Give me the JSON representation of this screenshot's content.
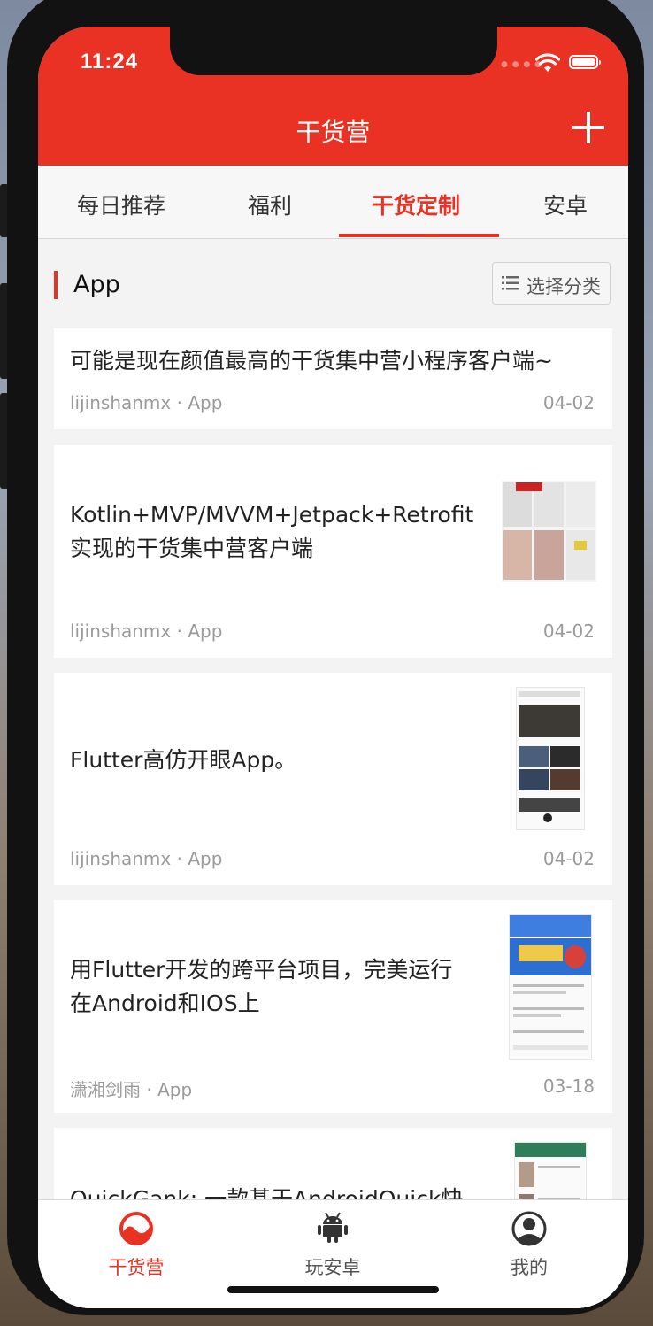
{
  "status_bar": {
    "time": "11:24"
  },
  "nav": {
    "title": "干货营"
  },
  "tabs": [
    {
      "label": "每日推荐"
    },
    {
      "label": "福利"
    },
    {
      "label": "干货定制"
    },
    {
      "label": "安卓"
    }
  ],
  "active_tab": "干货定制",
  "section": {
    "title": "App",
    "category_button": "选择分类"
  },
  "articles": [
    {
      "title": "可能是现在颜值最高的干货集中营小程序客户端~",
      "author": "lijinshanmx",
      "category": "App",
      "date": "04-02"
    },
    {
      "title": "Kotlin+MVP/MVVM+Jetpack+Retrofit实现的干货集中营客户端",
      "title_line1": "Kotlin+MVP/MVVM+Jetpack+Retrofit",
      "title_line2": "实现的干货集中营客户端",
      "author": "lijinshanmx",
      "category": "App",
      "date": "04-02"
    },
    {
      "title": "Flutter高仿开眼App。",
      "author": "lijinshanmx",
      "category": "App",
      "date": "04-02"
    },
    {
      "title": "用Flutter开发的跨平台项目，完美运行在Android和IOS上",
      "title_line1": "用Flutter开发的跨平台项目，完美运行",
      "title_line2": "在Android和IOS上",
      "author": "潇湘剑雨",
      "category": "App",
      "date": "03-18"
    },
    {
      "title": "QuickGank: 一款基于AndroidQuick快",
      "author": "",
      "category": "",
      "date": ""
    }
  ],
  "meta_separator": " · ",
  "tabbar": [
    {
      "label": "干货营",
      "icon": "ganhuoying-logo-icon",
      "active": true
    },
    {
      "label": "玩安卓",
      "icon": "android-icon",
      "active": false
    },
    {
      "label": "我的",
      "icon": "user-icon",
      "active": false
    }
  ],
  "colors": {
    "accent": "#e93223",
    "text": "#222222",
    "muted": "#9a9a9a",
    "background": "#f3f3f3"
  }
}
